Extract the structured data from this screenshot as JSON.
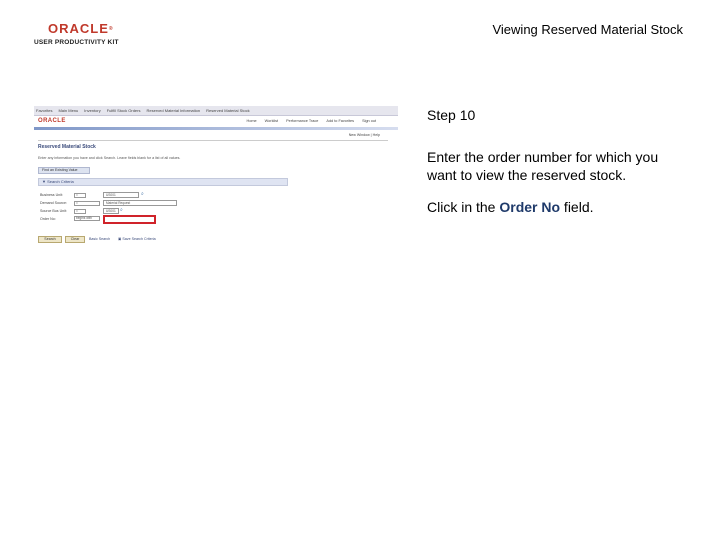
{
  "header": {
    "logo_text": "ORACLE",
    "logo_trademark": "®",
    "logo_subtitle": "USER PRODUCTIVITY KIT",
    "document_title": "Viewing Reserved Material Stock"
  },
  "screenshot": {
    "topnav": [
      "Favorites",
      "Main Menu",
      "Inventory",
      "Fulfill Stock Orders",
      "Reserved Material Information",
      "Reserved Material Stock"
    ],
    "subnav": [
      "Home",
      "Worklist",
      "Performance Trace",
      "Add to Favorites",
      "Sign out"
    ],
    "logo": "ORACLE",
    "page_links": "New Window | Help",
    "page_heading": "Reserved Material Stock",
    "instructions": "Enter any information you have and click Search. Leave fields blank for a list of all values.",
    "find_existing_button": "Find an Existing Value",
    "search_criteria_label": "Search Criteria",
    "fields": [
      {
        "label": "Business Unit:",
        "operator": "=",
        "value": "US001"
      },
      {
        "label": "Demand Source:",
        "operator": "=",
        "value": "Material Request"
      },
      {
        "label": "Source Bus Unit:",
        "operator": "=",
        "value": "US001"
      },
      {
        "label": "Order No:",
        "operator": "begins with",
        "value": ""
      }
    ],
    "search_button": "Search",
    "clear_button": "Clear",
    "basic_search_link": "Basic Search",
    "save_search_link": "Save Search Criteria"
  },
  "instructions": {
    "step": "Step 10",
    "description": "Enter the order number for which you want to view the reserved stock.",
    "click_prefix": "Click in the ",
    "click_target": "Order No",
    "click_suffix": " field."
  }
}
